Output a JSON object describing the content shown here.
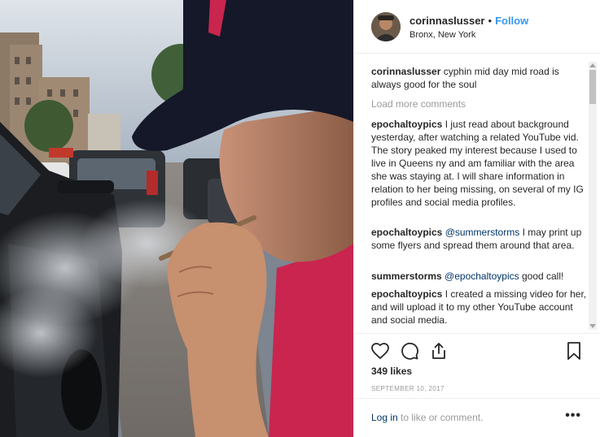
{
  "header": {
    "username": "corinnaslusser",
    "separator": "•",
    "follow_label": "Follow",
    "location": "Bronx, New York"
  },
  "comments": [
    {
      "author": "corinnaslusser",
      "text": "cyphin mid day mid road is always good for the soul"
    },
    {
      "author": "epochaltoypics",
      "text": "I just read about background yesterday, after watching a related YouTube vid. The story peaked my interest because I used to live in Queens ny and am familiar with the area she was staying at. I will share information in relation to her being missing, on several of my IG profiles and social media profiles."
    },
    {
      "author": "epochaltoypics",
      "mention": "@summerstorms",
      "text": "I may print up some flyers and spread them around that area."
    },
    {
      "author": "summerstorms",
      "mention": "@epochaltoypics",
      "text": "good call!"
    },
    {
      "author": "epochaltoypics",
      "text": "I created a missing video for her, and will upload it to my other YouTube account and social media."
    }
  ],
  "load_more_label": "Load more comments",
  "likes_label": "349 likes",
  "date_label": "SEPTEMBER 10, 2017",
  "footer": {
    "login_link": "Log in",
    "login_rest": "to like or comment.",
    "more_label": "•••"
  },
  "icons": {
    "like": "heart-icon",
    "comment": "comment-bubble-icon",
    "share": "share-icon",
    "save": "bookmark-icon"
  },
  "colors": {
    "follow": "#3897f0",
    "link": "#003569",
    "muted": "#999999",
    "text": "#262626",
    "cap": "#141829",
    "shirt": "#c9254f"
  }
}
